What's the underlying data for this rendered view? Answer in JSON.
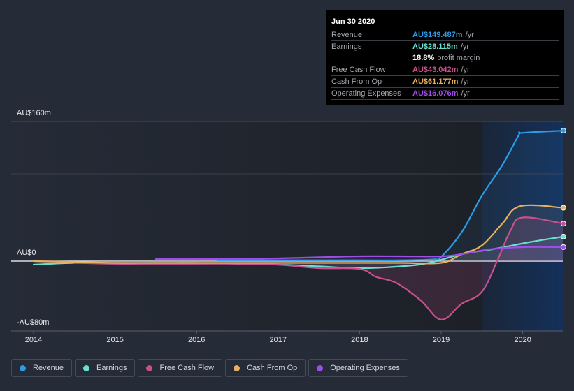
{
  "tooltip": {
    "date": "Jun 30 2020",
    "rows": [
      {
        "label": "Revenue",
        "value": "AU$149.487m",
        "unit": "/yr",
        "color": "#2d9be5"
      },
      {
        "label": "Earnings",
        "value": "AU$28.115m",
        "unit": "/yr",
        "color": "#6be0d0"
      },
      {
        "label": "",
        "value": "18.8%",
        "unit": "profit margin",
        "color": "#ffffff"
      },
      {
        "label": "Free Cash Flow",
        "value": "AU$43.042m",
        "unit": "/yr",
        "color": "#c8508c"
      },
      {
        "label": "Cash From Op",
        "value": "AU$61.177m",
        "unit": "/yr",
        "color": "#e8af60"
      },
      {
        "label": "Operating Expenses",
        "value": "AU$16.076m",
        "unit": "/yr",
        "color": "#9e4ee8"
      }
    ]
  },
  "chart_data": {
    "type": "line",
    "title": "",
    "xlabel": "",
    "ylabel": "",
    "y_tick_labels": [
      "AU$160m",
      "AU$0",
      "-AU$80m"
    ],
    "y_ticks": [
      160,
      0,
      -80
    ],
    "ylim": [
      -80,
      160
    ],
    "xlim": [
      2013.8,
      2020.5
    ],
    "x_tick_labels": [
      "2014",
      "2015",
      "2016",
      "2017",
      "2018",
      "2019",
      "2020"
    ],
    "x_ticks": [
      2014,
      2015,
      2016,
      2017,
      2018,
      2019,
      2020
    ],
    "gridlines": [
      160,
      100,
      0
    ],
    "highlight_range": [
      2019.5,
      2020.5
    ],
    "legend_position": "bottom-left",
    "series": [
      {
        "name": "Revenue",
        "color": "#2d9be5",
        "x": [
          2016.25,
          2017.0,
          2017.5,
          2018.0,
          2018.5,
          2018.9,
          2019.0,
          2019.25,
          2019.5,
          2019.75,
          2019.95,
          2020.0,
          2020.5
        ],
        "y": [
          1,
          1,
          1,
          1,
          1,
          2,
          5,
          33,
          75,
          110,
          144,
          147,
          149.487
        ]
      },
      {
        "name": "Earnings",
        "color": "#6be0d0",
        "x": [
          2014.0,
          2014.5,
          2015.0,
          2015.5,
          2016.0,
          2016.5,
          2017.0,
          2017.5,
          2018.0,
          2018.5,
          2018.85,
          2019.25,
          2019.65,
          2020.1,
          2020.5
        ],
        "y": [
          -4,
          -2,
          -2,
          -2,
          -2,
          -3,
          -4,
          -6,
          -8,
          -6,
          -2,
          8,
          14,
          22,
          28.115
        ]
      },
      {
        "name": "Free Cash Flow",
        "color": "#c8508c",
        "x": [
          2014.5,
          2015.0,
          2015.5,
          2016.0,
          2016.5,
          2017.0,
          2017.5,
          2018.0,
          2018.2,
          2018.45,
          2018.75,
          2019.0,
          2019.25,
          2019.5,
          2019.7,
          2019.85,
          2020.0,
          2020.5
        ],
        "y": [
          -2,
          -3,
          -3,
          -3,
          -3,
          -4,
          -8,
          -9,
          -18,
          -25,
          -45,
          -67,
          -49,
          -35,
          3,
          35,
          50,
          43.042
        ]
      },
      {
        "name": "Cash From Op",
        "color": "#e8af60",
        "x": [
          2014.0,
          2014.5,
          2015.0,
          2015.5,
          2016.0,
          2016.5,
          2017.0,
          2017.5,
          2018.0,
          2018.5,
          2019.0,
          2019.25,
          2019.5,
          2019.75,
          2019.97,
          2020.5
        ],
        "y": [
          0,
          -1,
          -2,
          -2,
          -2,
          -2,
          -2,
          -2,
          -2,
          -2,
          -2,
          8,
          18,
          43,
          63,
          61.177
        ]
      },
      {
        "name": "Operating Expenses",
        "color": "#9e4ee8",
        "x": [
          2015.5,
          2016.0,
          2016.5,
          2017.0,
          2017.5,
          2018.0,
          2018.5,
          2019.0,
          2019.25,
          2019.6,
          2020.0,
          2020.5
        ],
        "y": [
          2.4,
          2.4,
          2.6,
          3.2,
          4.5,
          5.6,
          5.6,
          5.5,
          8,
          13.6,
          16,
          16.076
        ]
      }
    ]
  },
  "legend": [
    {
      "label": "Revenue",
      "color": "#2d9be5"
    },
    {
      "label": "Earnings",
      "color": "#6be0d0"
    },
    {
      "label": "Free Cash Flow",
      "color": "#c8508c"
    },
    {
      "label": "Cash From Op",
      "color": "#e8af60"
    },
    {
      "label": "Operating Expenses",
      "color": "#9e4ee8"
    }
  ]
}
